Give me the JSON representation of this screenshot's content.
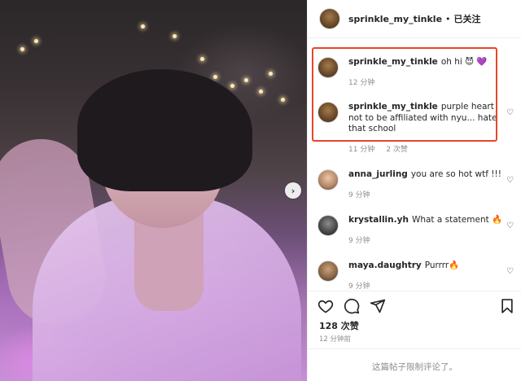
{
  "post": {
    "username": "sprinkle_my_tinkle",
    "separator": "•",
    "follow_label": "已关注"
  },
  "comments": [
    {
      "username": "sprinkle_my_tinkle",
      "text": "oh hi 😈 💜",
      "time": "12 分钟",
      "likes": "",
      "highlighted": true
    },
    {
      "username": "sprinkle_my_tinkle",
      "text": "purple heart not to be affiliated with nyu... hate that school",
      "time": "11 分钟",
      "likes": "2 次赞",
      "highlighted": true
    },
    {
      "username": "anna_jurling",
      "text": "you are so hot wtf !!!",
      "time": "9 分钟",
      "likes": ""
    },
    {
      "username": "krystallin.yh",
      "text": "What a statement 🔥",
      "time": "9 分钟",
      "likes": ""
    },
    {
      "username": "maya.daughtry",
      "text": "Purrrr🔥",
      "time": "9 分钟",
      "likes": ""
    }
  ],
  "footer": {
    "likes_count": "128 次赞",
    "posted_time": "12 分钟前",
    "comments_limited": "这篇帖子限制评论了。"
  },
  "colors": {
    "highlight_border": "#e8452c",
    "muted_text": "#8e8e8e",
    "primary_text": "#262626"
  },
  "icons": [
    "chevron-right-icon",
    "heart-outline-icon",
    "comment-bubble-icon",
    "share-paper-plane-icon",
    "bookmark-icon"
  ]
}
